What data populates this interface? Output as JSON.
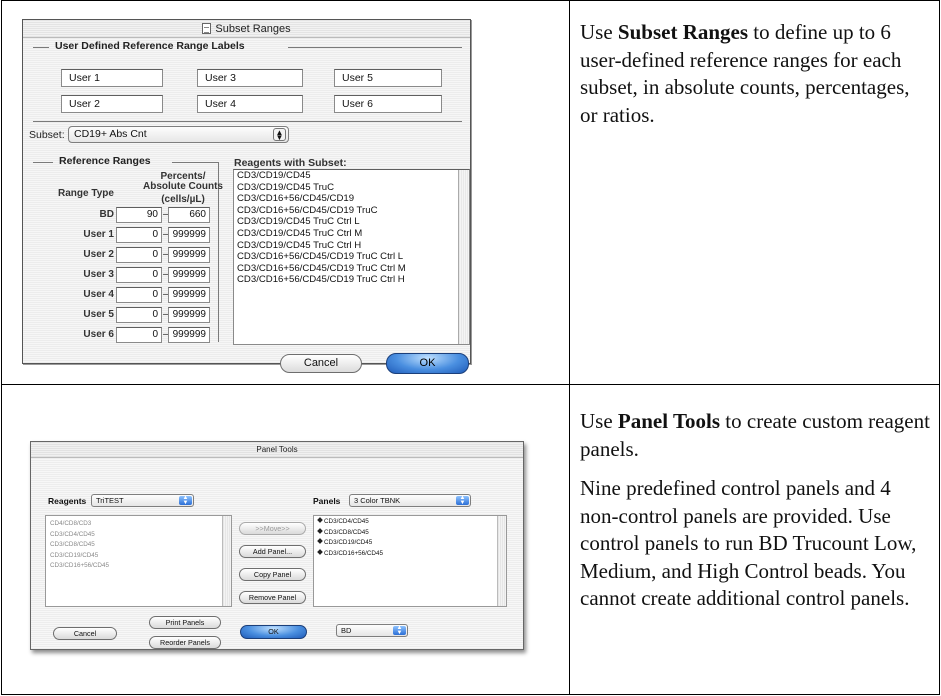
{
  "subset_dialog": {
    "title": "Subset Ranges",
    "user_labels_group": "User Defined Reference Range Labels",
    "user_labels": [
      "User 1",
      "User 3",
      "User 5",
      "User 2",
      "User 4",
      "User 6"
    ],
    "subset_label": "Subset:",
    "subset_value": "CD19+ Abs Cnt",
    "ref_ranges_group": "Reference Ranges",
    "range_type_header": "Range Type",
    "counts_header_1": "Percents/",
    "counts_header_2": "Absolute Counts",
    "counts_header_3": "(cells/µL)",
    "ranges": [
      {
        "label": "BD",
        "low": "90",
        "high": "660"
      },
      {
        "label": "User 1",
        "low": "0",
        "high": "999999"
      },
      {
        "label": "User 2",
        "low": "0",
        "high": "999999"
      },
      {
        "label": "User 3",
        "low": "0",
        "high": "999999"
      },
      {
        "label": "User 4",
        "low": "0",
        "high": "999999"
      },
      {
        "label": "User 5",
        "low": "0",
        "high": "999999"
      },
      {
        "label": "User 6",
        "low": "0",
        "high": "999999"
      }
    ],
    "dash": "–",
    "reagents_header": "Reagents with Subset:",
    "reagents": [
      "CD3/CD19/CD45",
      "CD3/CD19/CD45 TruC",
      "CD3/CD16+56/CD45/CD19",
      "CD3/CD16+56/CD45/CD19 TruC",
      "CD3/CD19/CD45 TruC Ctrl L",
      "CD3/CD19/CD45 TruC Ctrl M",
      "CD3/CD19/CD45 TruC Ctrl H",
      "CD3/CD16+56/CD45/CD19 TruC Ctrl L",
      "CD3/CD16+56/CD45/CD19 TruC Ctrl M",
      "CD3/CD16+56/CD45/CD19 TruC Ctrl H"
    ],
    "cancel_label": "Cancel",
    "ok_label": "OK"
  },
  "desc1": {
    "bold": "Subset Ranges",
    "pre": "Use ",
    "post": " to define up to 6 user-defined reference ranges for each subset, in absolute counts, percentages, or ratios."
  },
  "panel_dialog": {
    "title": "Panel Tools",
    "reagents_label": "Reagents",
    "reagents_value": "TriTEST",
    "panels_label": "Panels",
    "panels_value": "3 Color TBNK",
    "reagent_items": [
      "CD4/CD8/CD3",
      "CD3/CD4/CD45",
      "CD3/CD8/CD45",
      "CD3/CD19/CD45",
      "CD3/CD16+56/CD45"
    ],
    "panel_items": [
      "CD3/CD4/CD45",
      "CD3/CD8/CD45",
      "CD3/CD19/CD45",
      "CD3/CD16+56/CD45"
    ],
    "move_label": ">>Move>>",
    "add_label": "Add Panel...",
    "copy_label": "Copy Panel",
    "remove_label": "Remove Panel",
    "cancel_label": "Cancel",
    "print_label": "Print Panels",
    "reorder_label": "Reorder Panels",
    "ok_label": "OK",
    "bd_value": "BD"
  },
  "desc2": {
    "pre": "Use ",
    "bold": "Panel Tools",
    "post": " to create custom reagent panels.",
    "para2": "Nine predefined control panels and 4 non-control panels are provided. Use control panels to run BD Trucount Low, Medium, and High Control beads. You cannot create additional control panels."
  }
}
